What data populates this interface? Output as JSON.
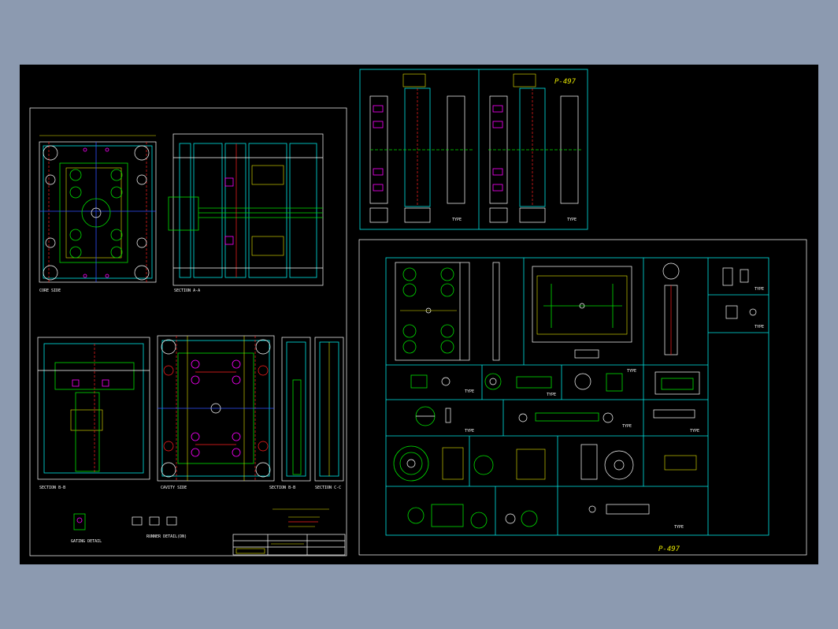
{
  "colors": {
    "background": "#8c9ab0",
    "sheet": "#000000",
    "white": "#ffffff",
    "cyan": "#00e5e5",
    "green": "#00e000",
    "yellow": "#e8e800",
    "red": "#ff2020",
    "magenta": "#ff00ff",
    "blue": "#3050ff"
  },
  "labels": {
    "core_side": "CORE SIDE",
    "section_aa": "SECTION A-A",
    "section_bb": "SECTION B-B",
    "cavity_side": "CAVITY SIDE",
    "section_bb2": "SECTION B-B",
    "section_cc": "SECTION C-C",
    "gating_detail": "GATING DETAIL",
    "runner_detail": "RUNNER DETAIL(DN)"
  },
  "drawing_no": {
    "upper": "P-497",
    "lower": "P-497"
  },
  "type_labels": {
    "t1": "TYPE",
    "t2": "TYPE",
    "t3": "TYPE",
    "t4": "TYPE",
    "t5": "TYPE",
    "t6": "TYPE",
    "t7": "TYPE",
    "t8": "TYPE",
    "t9": "TYPE",
    "t10": "TYPE",
    "t11": "TYPE"
  }
}
